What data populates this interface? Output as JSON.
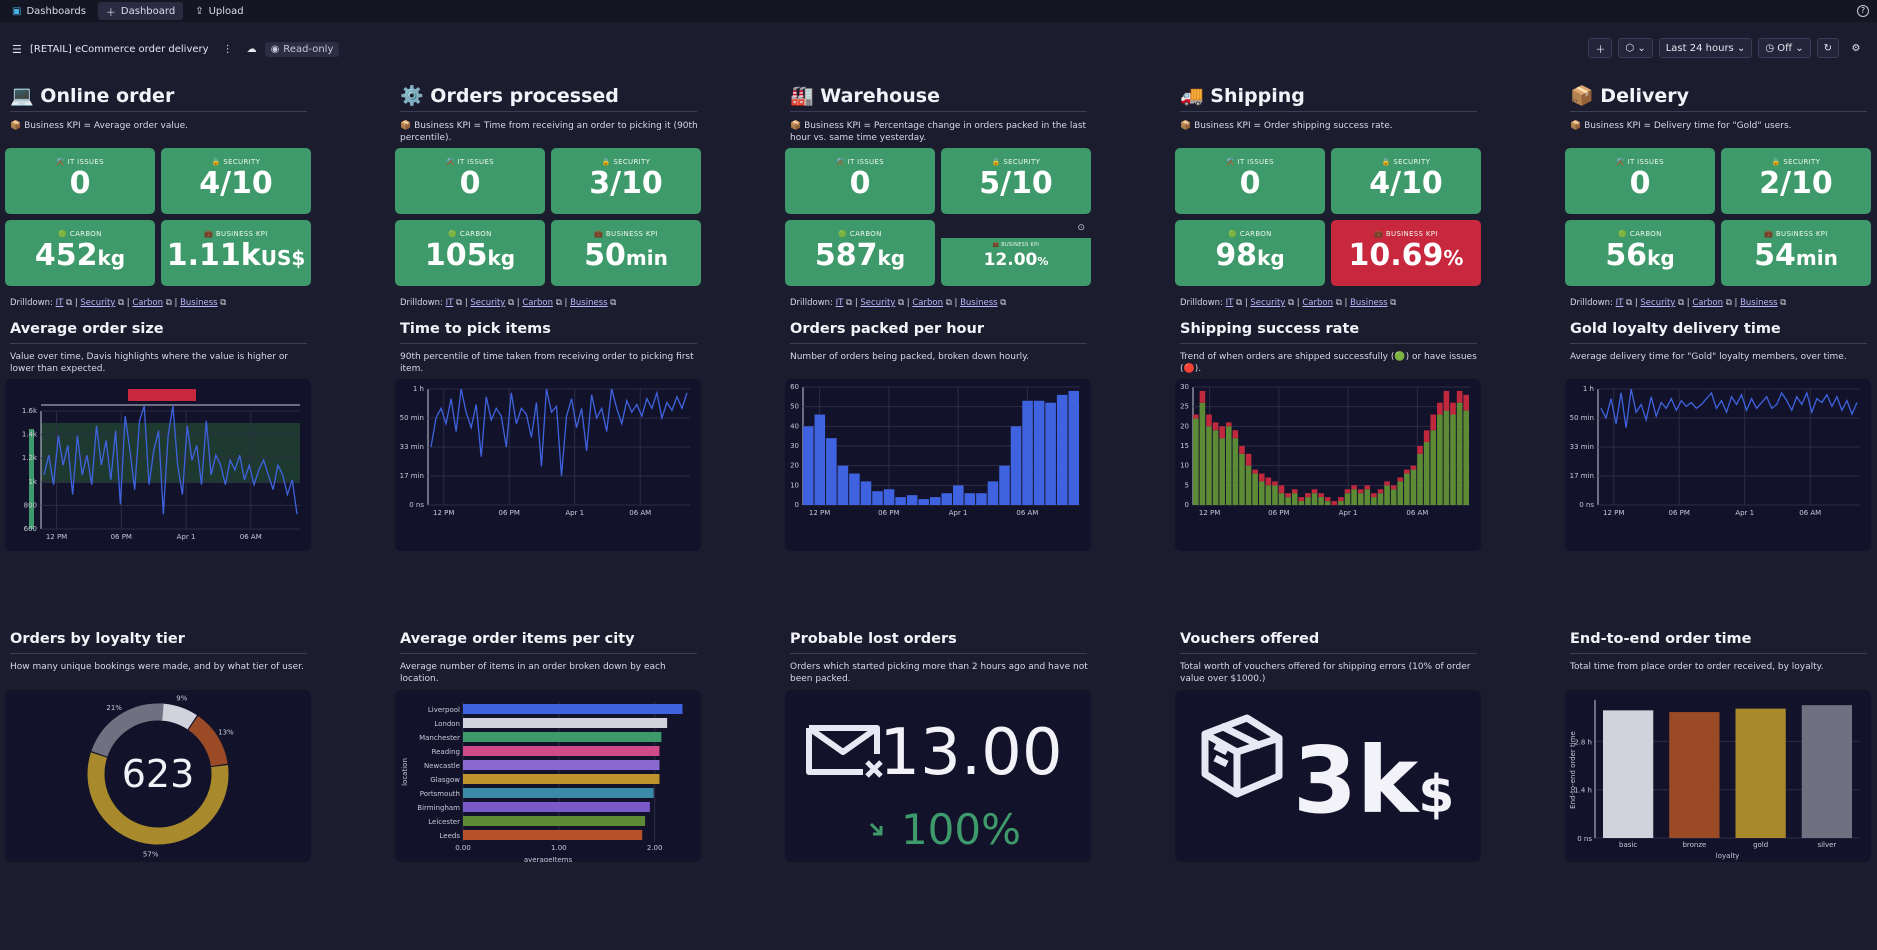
{
  "topbar": {
    "items": [
      "Dashboards",
      "Dashboard",
      "Upload"
    ]
  },
  "subbar": {
    "title": "[RETAIL] eCommerce order delivery",
    "mode": "Read-only",
    "timeframe": "Last 24 hours",
    "refresh": "Off"
  },
  "columns": [
    {
      "title": "Online order",
      "icon": "💻",
      "kpi": "📦 Business KPI = Average order value.",
      "tiles": [
        {
          "label": "⚒️ IT ISSUES",
          "value": "0",
          "unit": ""
        },
        {
          "label": "🔒 SECURITY",
          "value": "4/10",
          "unit": ""
        },
        {
          "label": "🟢 CARBON",
          "value": "452",
          "unit": "kg"
        },
        {
          "label": "💼 BUSINESS KPI",
          "value": "1.11k",
          "unit": "US$"
        }
      ],
      "chart_title": "Average order size",
      "chart_desc": "Value over time, Davis highlights where the value is higher or lower than expected."
    },
    {
      "title": "Orders processed",
      "icon": "⚙️",
      "kpi": "📦 Business KPI = Time from receiving an order to picking it (90th percentile).",
      "tiles": [
        {
          "label": "⚒️ IT ISSUES",
          "value": "0",
          "unit": ""
        },
        {
          "label": "🔒 SECURITY",
          "value": "3/10",
          "unit": ""
        },
        {
          "label": "🟢 CARBON",
          "value": "105",
          "unit": "kg"
        },
        {
          "label": "💼 BUSINESS KPI",
          "value": "50",
          "unit": "min"
        }
      ],
      "chart_title": "Time to pick items",
      "chart_desc": "90th percentile of time taken from receiving order to picking first item."
    },
    {
      "title": "Warehouse",
      "icon": "🏭",
      "kpi": "📦 Business KPI = Percentage change in orders packed in the last hour vs. same time yesterday.",
      "tiles": [
        {
          "label": "⚒️ IT ISSUES",
          "value": "0",
          "unit": ""
        },
        {
          "label": "🔒 SECURITY",
          "value": "5/10",
          "unit": ""
        },
        {
          "label": "🟢 CARBON",
          "value": "587",
          "unit": "kg"
        },
        {
          "label": "💼 BUSINESS KPI",
          "value": "12.00",
          "unit": "%"
        }
      ],
      "chart_title": "Orders packed per hour",
      "chart_desc": "Number of orders being packed, broken down hourly."
    },
    {
      "title": "Shipping",
      "icon": "🚚",
      "kpi": "📦 Business KPI = Order shipping success rate.",
      "tiles": [
        {
          "label": "⚒️ IT ISSUES",
          "value": "0",
          "unit": ""
        },
        {
          "label": "🔒 SECURITY",
          "value": "4/10",
          "unit": ""
        },
        {
          "label": "🟢 CARBON",
          "value": "98",
          "unit": "kg"
        },
        {
          "label": "💼 BUSINESS KPI",
          "value": "10.69",
          "unit": "%"
        }
      ],
      "chart_title": "Shipping success rate",
      "chart_desc": "Trend of when orders are shipped successfully (🟢) or have issues (🔴)."
    },
    {
      "title": "Delivery",
      "icon": "📦",
      "kpi": "📦 Business KPI = Delivery time for \"Gold\" users.",
      "tiles": [
        {
          "label": "⚒️ IT ISSUES",
          "value": "0",
          "unit": ""
        },
        {
          "label": "🔒 SECURITY",
          "value": "2/10",
          "unit": ""
        },
        {
          "label": "🟢 CARBON",
          "value": "56",
          "unit": "kg"
        },
        {
          "label": "💼 BUSINESS KPI",
          "value": "54",
          "unit": "min"
        }
      ],
      "chart_title": "Gold loyalty delivery time",
      "chart_desc": "Average delivery time for \"Gold\" loyalty members, over time."
    }
  ],
  "drilldown": {
    "label": "Drilldown:",
    "links": [
      "IT",
      "Security",
      "Carbon",
      "Business"
    ]
  },
  "row2": [
    {
      "title": "Orders by loyalty tier",
      "desc": "How many unique bookings were made, and by what tier of user."
    },
    {
      "title": "Average order items per city",
      "desc": "Average number of items in an order broken down by each location."
    },
    {
      "title": "Probable lost orders",
      "desc": "Orders which started picking more than 2 hours ago and have not been packed."
    },
    {
      "title": "Vouchers offered",
      "desc": "Total worth of vouchers offered for shipping errors (10% of order value over $1000.)"
    },
    {
      "title": "End-to-end order time",
      "desc": "Total time from place order to order received, by loyalty."
    }
  ],
  "lost_orders": {
    "value": "13.00",
    "change": "100%"
  },
  "vouchers": {
    "value": "3k",
    "unit": "$"
  },
  "colors": {
    "tile_green": "#3e9a6a",
    "tile_red": "#c8283e",
    "line_blue": "#3f63e0",
    "bar_green": "#5d8a34",
    "bar_red": "#c0283e"
  },
  "chart_data": [
    {
      "type": "line",
      "title": "Average order size",
      "x_ticks": [
        "12 PM",
        "06 PM",
        "Apr 1",
        "06 AM"
      ],
      "y_ticks": [
        "600",
        "800",
        "1k",
        "1.2k",
        "1.4k",
        "1.6k"
      ],
      "values": [
        1100,
        1300,
        1000,
        1500,
        1200,
        1400,
        900,
        1500,
        1100,
        1300,
        1000,
        1600,
        1200,
        1450,
        1050,
        1550,
        800,
        1700,
        1350,
        950,
        1650,
        1800,
        1000,
        1350,
        1550,
        700,
        1500,
        1800,
        1200,
        900,
        1600,
        1250,
        1400,
        1000,
        1650,
        1100,
        1300,
        1200,
        1000,
        1250,
        1150,
        1300,
        1050,
        1200,
        1000,
        1150,
        1250,
        1100,
        950,
        1200,
        1100,
        900,
        1050,
        700
      ]
    },
    {
      "type": "line",
      "title": "Time to pick items",
      "x_ticks": [
        "12 PM",
        "06 PM",
        "Apr 1",
        "06 AM"
      ],
      "y_ticks": [
        "0 ns",
        "17 min",
        "33 min",
        "50 min",
        "1 h"
      ],
      "values": [
        30,
        45,
        50,
        42,
        55,
        38,
        60,
        48,
        40,
        52,
        25,
        56,
        44,
        50,
        46,
        30,
        58,
        42,
        50,
        47,
        35,
        53,
        20,
        60,
        48,
        51,
        15,
        46,
        55,
        40,
        50,
        28,
        57,
        45,
        50,
        38,
        60,
        50,
        42,
        54,
        48,
        52,
        46,
        55,
        50,
        58,
        45,
        53,
        49,
        56,
        50,
        58
      ]
    },
    {
      "type": "bar",
      "title": "Orders packed per hour",
      "x_ticks": [
        "12 PM",
        "06 PM",
        "Apr 1",
        "06 AM"
      ],
      "y_ticks": [
        "0",
        "10",
        "20",
        "30",
        "40",
        "50",
        "60"
      ],
      "values": [
        40,
        46,
        34,
        20,
        16,
        12,
        7,
        8,
        4,
        5,
        3,
        4,
        6,
        10,
        6,
        6,
        12,
        20,
        40,
        53,
        53,
        52,
        56,
        58
      ]
    },
    {
      "type": "bar",
      "stacked": true,
      "title": "Shipping success rate",
      "x_ticks": [
        "12 PM",
        "06 PM",
        "Apr 1",
        "06 AM"
      ],
      "y_ticks": [
        "0",
        "5",
        "10",
        "15",
        "20",
        "25",
        "30"
      ],
      "series": [
        {
          "name": "success",
          "values": [
            22,
            26,
            20,
            19,
            17,
            20,
            17,
            13,
            10,
            8,
            6,
            5,
            5,
            3,
            2,
            3,
            1,
            2,
            3,
            2,
            1,
            0,
            1,
            3,
            4,
            3,
            4,
            2,
            3,
            5,
            4,
            6,
            8,
            9,
            13,
            16,
            19,
            23,
            24,
            23,
            26,
            24
          ]
        },
        {
          "name": "issues",
          "values": [
            1,
            3,
            3,
            2,
            3,
            1,
            2,
            2,
            3,
            1,
            2,
            2,
            1,
            2,
            1,
            1,
            1,
            1,
            1,
            1,
            1,
            1,
            1,
            1,
            1,
            1,
            1,
            1,
            1,
            1,
            1,
            1,
            1,
            1,
            2,
            3,
            4,
            3,
            5,
            3,
            3,
            4
          ]
        }
      ]
    },
    {
      "type": "line",
      "title": "Gold loyalty delivery time",
      "x_ticks": [
        "12 PM",
        "06 PM",
        "Apr 1",
        "06 AM"
      ],
      "y_ticks": [
        "0 ns",
        "17 min",
        "33 min",
        "50 min",
        "1 h"
      ],
      "values": [
        50,
        45,
        55,
        42,
        58,
        40,
        60,
        48,
        52,
        44,
        56,
        46,
        53,
        50,
        55,
        49,
        54,
        51,
        53,
        50,
        52,
        55,
        58,
        50,
        54,
        48,
        56,
        52,
        57,
        49,
        55,
        50,
        53,
        56,
        50,
        52,
        58,
        54,
        49,
        56,
        52,
        58,
        48,
        55,
        53,
        57,
        51,
        56,
        49,
        54,
        47,
        53
      ]
    },
    {
      "type": "pie",
      "title": "Orders by loyalty tier",
      "center": "623",
      "slices": [
        {
          "label": "9%",
          "value": 9,
          "color": "#d2d2dc"
        },
        {
          "label": "13%",
          "value": 13,
          "color": "#9a4a24"
        },
        {
          "label": "57%",
          "value": 57,
          "color": "#a8892c"
        },
        {
          "label": "21%",
          "value": 21,
          "color": "#707080"
        }
      ]
    },
    {
      "type": "bar",
      "orientation": "horizontal",
      "title": "Average order items per city",
      "xlabel": "averageItems",
      "ylabel": "location",
      "x_ticks": [
        "0.00",
        "1.00",
        "2.00"
      ],
      "categories": [
        "Liverpool",
        "London",
        "Manchester",
        "Reading",
        "Newcastle",
        "Glasgow",
        "Portsmouth",
        "Birmingham",
        "Leicester",
        "Leeds"
      ],
      "values": [
        2.29,
        2.13,
        2.07,
        2.05,
        2.05,
        2.05,
        1.99,
        1.95,
        1.9,
        1.87
      ],
      "colors": [
        "#3f63e0",
        "#d2d2dc",
        "#3e9a6a",
        "#d04a8a",
        "#8a6ad0",
        "#c0942c",
        "#3a8aa8",
        "#7a5ac8",
        "#5d8a34",
        "#b8502c"
      ]
    },
    {
      "type": "bar",
      "title": "End-to-end order time",
      "xlabel": "loyalty",
      "ylabel": "End-to-end order time",
      "y_ticks": [
        "0 ns",
        "1.4 h",
        "2.8 h"
      ],
      "categories": [
        "basic",
        "bronze",
        "gold",
        "silver"
      ],
      "values": [
        3.7,
        3.65,
        3.75,
        3.85
      ],
      "colors": [
        "#d2d2dc",
        "#9a4a24",
        "#a8892c",
        "#707080"
      ]
    }
  ]
}
